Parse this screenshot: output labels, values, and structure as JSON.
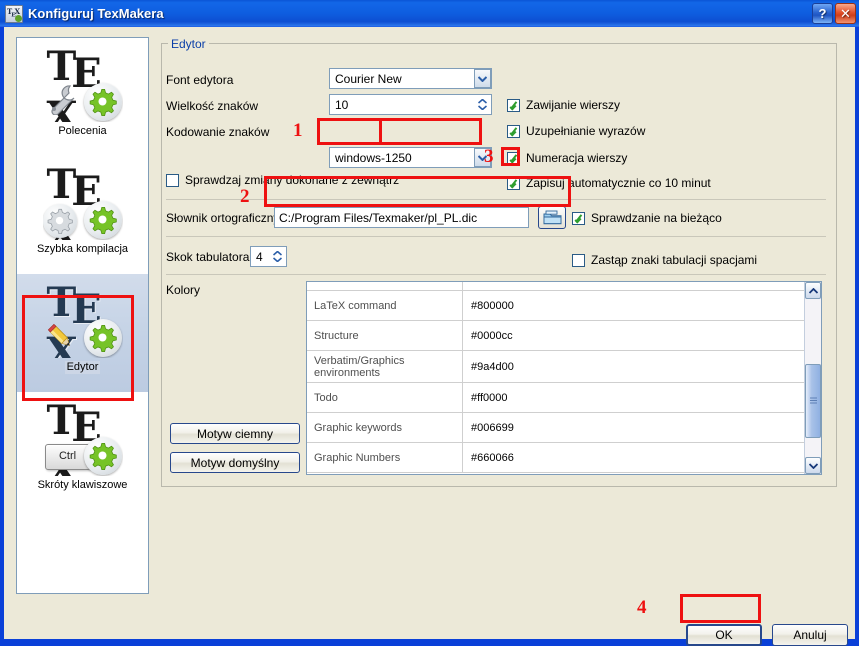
{
  "window": {
    "title": "Konfiguruj TexMakera",
    "icon": "tex-document-icon",
    "help_button": "?",
    "close_button": "✕"
  },
  "sidebar": {
    "items": [
      {
        "label": "Polecenia",
        "icon": "tex-wrench-gear-icon",
        "selected": false
      },
      {
        "label": "Szybka kompilacja",
        "icon": "tex-gear-gear-icon",
        "selected": false
      },
      {
        "label": "Edytor",
        "icon": "tex-pencil-gear-icon",
        "selected": true
      },
      {
        "label": "Skróty klawiszowe",
        "icon": "tex-ctrl-gear-icon",
        "selected": false
      }
    ]
  },
  "editor_group": {
    "title": "Edytor",
    "font_label": "Font edytora",
    "font_value": "Courier New",
    "size_label": "Wielkość znaków",
    "size_value": "10",
    "encoding_label": "Kodowanie znaków",
    "encoding_value": "windows-1250",
    "watch_external_label": "Sprawdzaj zmiany dokonane z zewnątrz",
    "watch_external_checked": false,
    "dictionary_label": "Słownik ortograficzny",
    "dictionary_value": "C:/Program Files/Texmaker/pl_PL.dic",
    "browse_icon": "folder-open-icon",
    "tabwidth_label": "Skok tabulatora",
    "tabwidth_value": "4",
    "checkboxes_right": [
      {
        "label": "Zawijanie wierszy",
        "checked": true
      },
      {
        "label": "Uzupełnianie wyrazów",
        "checked": true
      },
      {
        "label": "Numeracja wierszy",
        "checked": true
      },
      {
        "label": "Zapisuj automatycznie co 10 minut",
        "checked": true
      }
    ],
    "inline_spellcheck_label": "Sprawdzanie na bieżąco",
    "inline_spellcheck_checked": true,
    "replace_tabs_label": "Zastąp znaki tabulacji spacjami",
    "replace_tabs_checked": false,
    "colors_label": "Kolory",
    "dark_theme_button": "Motyw ciemny",
    "default_theme_button": "Motyw domyślny"
  },
  "colors_table": {
    "rows": [
      {
        "name": "LaTeX command",
        "value": "#800000"
      },
      {
        "name": "Structure",
        "value": "#0000cc"
      },
      {
        "name": "Verbatim/Graphics environments",
        "value": "#9a4d00"
      },
      {
        "name": "Todo",
        "value": "#ff0000"
      },
      {
        "name": "Graphic keywords",
        "value": "#006699"
      },
      {
        "name": "Graphic Numbers",
        "value": "#660066"
      }
    ],
    "scroll_up_icon": "chevron-up-icon",
    "scroll_down_icon": "chevron-down-icon"
  },
  "footer": {
    "ok_label": "OK",
    "cancel_label": "Anuluj"
  },
  "annotations": {
    "numbers": [
      "1",
      "2",
      "3",
      "4"
    ],
    "color": "#ee1111"
  }
}
